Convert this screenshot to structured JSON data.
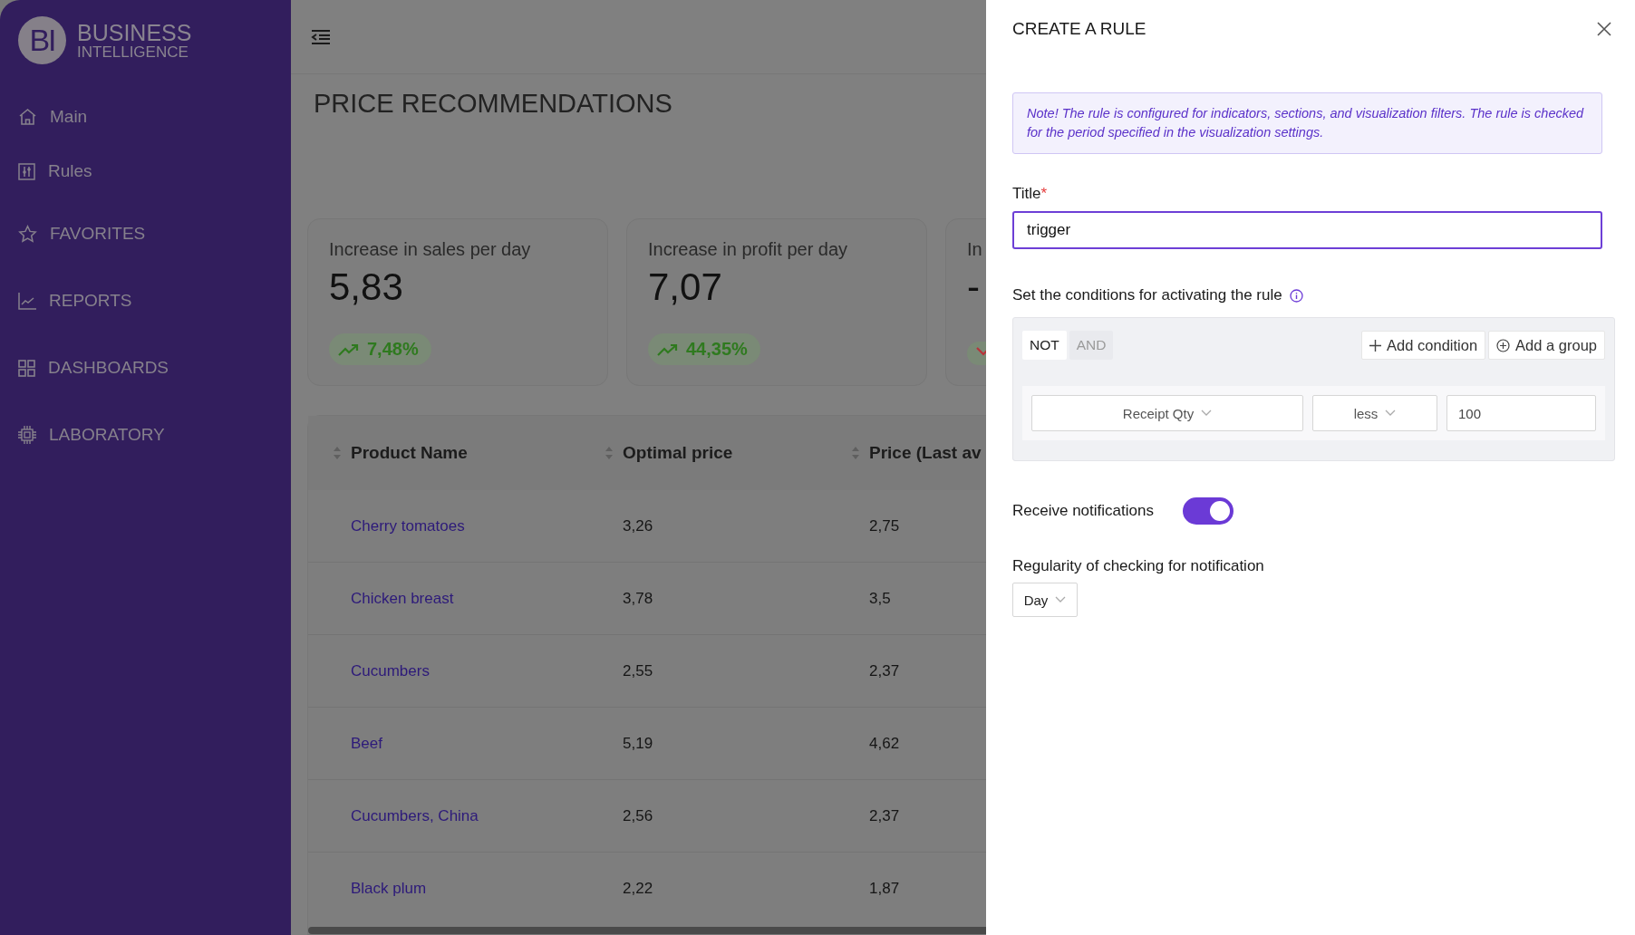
{
  "sidebar": {
    "logo": {
      "mark": "BI",
      "line1": "BUSINESS",
      "line2": "INTELLIGENCE"
    },
    "items": [
      {
        "label": "Main"
      },
      {
        "label": "Rules"
      },
      {
        "label": "FAVORITES"
      },
      {
        "label": "REPORTS"
      },
      {
        "label": "DASHBOARDS"
      },
      {
        "label": "LABORATORY"
      }
    ]
  },
  "main": {
    "title": "PRICE RECOMMENDATIONS",
    "cards": [
      {
        "label": "Increase in sales per day",
        "value": "5,83",
        "change": "7,48%",
        "kind": "up"
      },
      {
        "label": "Increase in profit per day",
        "value": "7,07",
        "change": "44,35%",
        "kind": "up"
      },
      {
        "label": "In",
        "value": "-",
        "kind": "down"
      }
    ],
    "table": {
      "columns": [
        "Product Name",
        "Optimal price",
        "Price (Last av"
      ],
      "rows": [
        [
          "Cherry tomatoes",
          "3,26",
          "2,75"
        ],
        [
          "Chicken breast",
          "3,78",
          "3,5"
        ],
        [
          "Cucumbers",
          "2,55",
          "2,37"
        ],
        [
          "Beef",
          "5,19",
          "4,62"
        ],
        [
          "Cucumbers, China",
          "2,56",
          "2,37"
        ],
        [
          "Black plum",
          "2,22",
          "1,87"
        ]
      ]
    }
  },
  "drawer": {
    "title": "CREATE A RULE",
    "note": "Note! The rule is configured for indicators, sections, and visualization filters. The rule is checked for the period specified in the visualization settings.",
    "title_field": {
      "label": "Title",
      "required_mark": "*",
      "value": "trigger"
    },
    "conditions": {
      "label": "Set the conditions for activating the rule",
      "operators": [
        {
          "label": "NOT",
          "selected": true
        },
        {
          "label": "AND",
          "selected": false
        }
      ],
      "actions": [
        "Add condition",
        "Add a group"
      ],
      "rule": {
        "field": "Receipt Qty",
        "operator": "less",
        "value": "100"
      }
    },
    "notifications": {
      "label": "Receive notifications",
      "on": true
    },
    "regularity": {
      "label": "Regularity of checking for notification",
      "value": "Day"
    }
  }
}
